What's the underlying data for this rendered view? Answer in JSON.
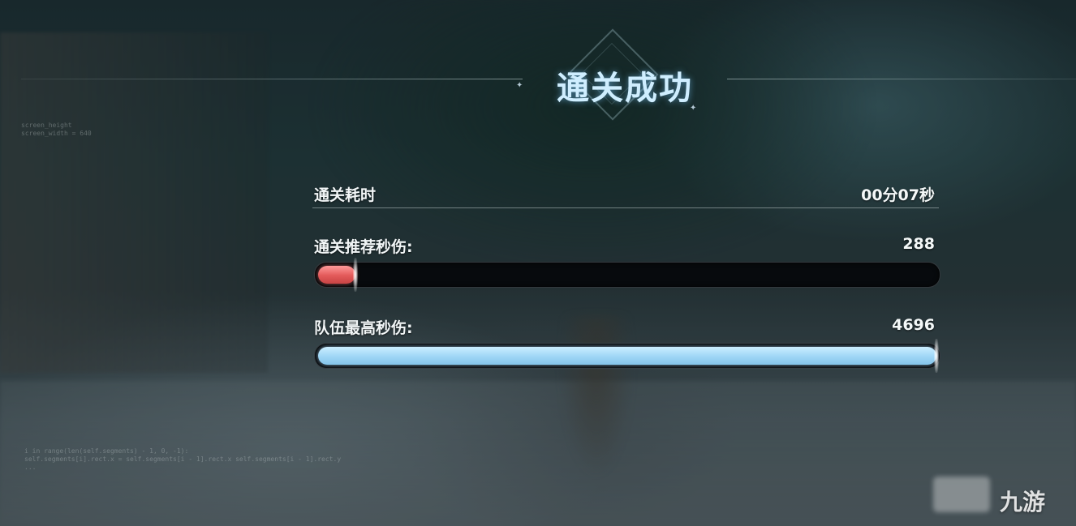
{
  "title": "通关成功",
  "stats": {
    "clear_time": {
      "label": "通关耗时",
      "value": "00分07秒"
    },
    "recommended_dps": {
      "label": "通关推荐秒伤:",
      "value": "288",
      "fill_fraction": 0.061,
      "color": "#e35a5a"
    },
    "team_max_dps": {
      "label": "队伍最高秒伤:",
      "value": "4696",
      "fill_fraction": 1.0,
      "color": "#9fd6f6"
    }
  },
  "debug": {
    "top": "screen_height\nscreen_width = 640",
    "bottom": "i in range(len(self.segments) - 1, 0, -1):\nself.segments[i].rect.x = self.segments[i - 1].rect.x self.segments[i - 1].rect.y\n..."
  },
  "watermark": {
    "text": "九游",
    "icon": "jiuyou-logo-icon"
  }
}
